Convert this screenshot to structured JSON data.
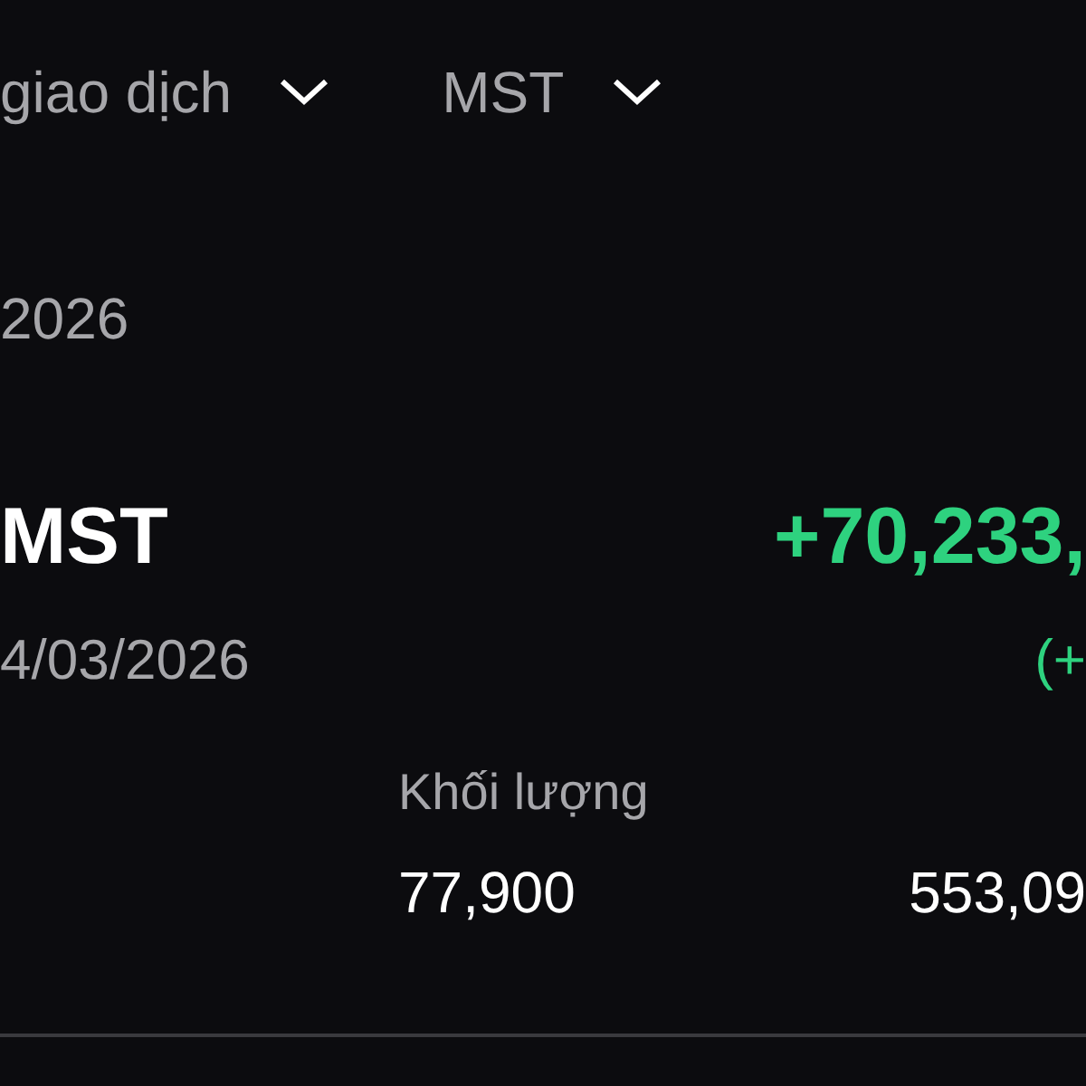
{
  "filters": [
    {
      "label": "giao dịch"
    },
    {
      "label": "MST"
    }
  ],
  "date": "2026",
  "trade": {
    "symbol": "MST",
    "amount": "+70,233,",
    "date": "4/03/2026",
    "change": "(+"
  },
  "stats": {
    "label": "Khối lượng",
    "values": [
      "77,900",
      "553,09"
    ]
  }
}
